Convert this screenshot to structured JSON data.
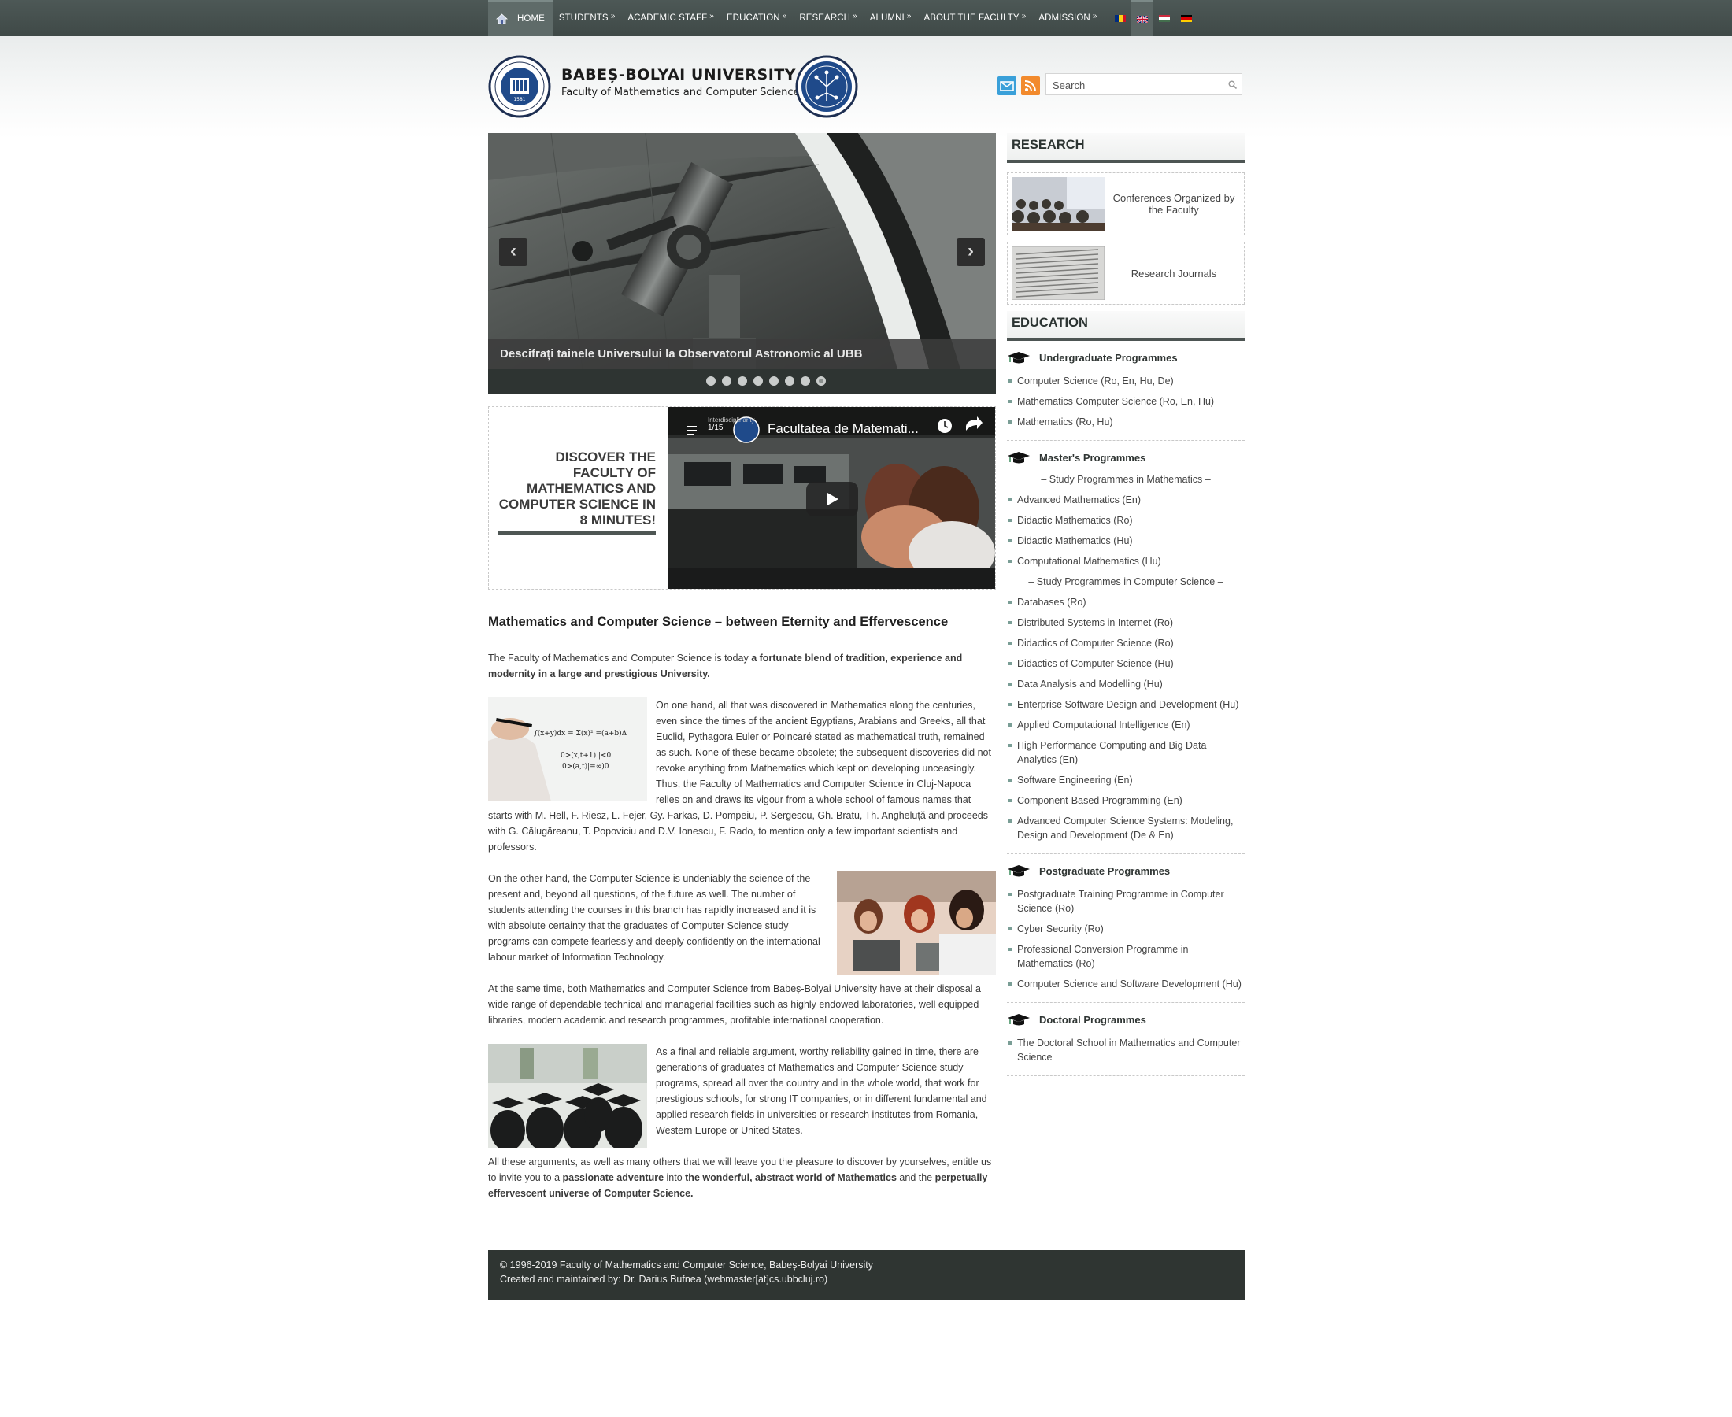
{
  "nav": {
    "items": [
      {
        "label": "HOME",
        "arrow": ""
      },
      {
        "label": "STUDENTS",
        "arrow": "»"
      },
      {
        "label": "ACADEMIC STAFF",
        "arrow": "»"
      },
      {
        "label": "EDUCATION",
        "arrow": "»"
      },
      {
        "label": "RESEARCH",
        "arrow": "»"
      },
      {
        "label": "ALUMNI",
        "arrow": "»"
      },
      {
        "label": "ABOUT THE FACULTY",
        "arrow": "»"
      },
      {
        "label": "ADMISSION",
        "arrow": "»"
      }
    ],
    "flags": [
      "romanian-flag-icon",
      "uk-flag-icon",
      "hungarian-flag-icon",
      "german-flag-icon"
    ],
    "bar_color": "#454f4d"
  },
  "header": {
    "title": "BABEȘ-BOLYAI UNIVERSITY",
    "subtitle": "Faculty of Mathematics and Computer Science",
    "seal_icon": "university-seal-icon",
    "faculty_icon": "faculty-logo-icon"
  },
  "search": {
    "placeholder": "Search",
    "value": ""
  },
  "slider": {
    "caption": "Descifrați tainele Universului la Observatorul Astronomic al UBB",
    "prev": "‹",
    "next": "›",
    "slide_count": 8,
    "active_slide": 8
  },
  "discover": {
    "text": "DISCOVER THE FACULTY OF MATHEMATICS AND COMPUTER SCIENCE IN 8 MINUTES!",
    "video_title": "Facultatea de Matemati...",
    "video_counter": "1/15",
    "video_tag": "Interdisciplinarity"
  },
  "article": {
    "title": "Mathematics and Computer Science – between Eternity and Effervescence",
    "p1_plain": "The Faculty of Mathematics and Computer Science is today ",
    "p1_bold": "a fortunate blend of tradition, experience and modernity in a large and prestigious University.",
    "p2": "On one hand, all that was discovered in Mathematics along the centuries, even since the times of the ancient Egyptians, Arabians and Greeks, all that Euclid, Pythagora Euler or Poincaré stated as mathematical truth, remained as such. None of these became obsolete; the subsequent discoveries did not revoke anything from Mathematics which kept on developing unceasingly. Thus, the Faculty of Mathematics and Computer Science in Cluj-Napoca relies on and draws its vigour from a whole school of famous names that starts with M. Hell, F. Riesz, L. Fejer, Gy. Farkas, D. Pompeiu, P. Sergescu, Gh. Bratu, Th. Angheluță and proceeds with G. Călugăreanu, T. Popoviciu and D.V. Ionescu, F. Rado, to mention only a few important scientists and professors.",
    "p3": "On the other hand, the Computer Science is undeniably the science of the present and, beyond all questions, of the future as well. The number of students attending the courses in this branch has rapidly increased and it is with absolute certainty that the graduates of Computer Science study programs can compete fearlessly and deeply confidently on the international labour market of Information Technology.",
    "p4": "At the same time, both Mathematics and Computer Science from Babeș-Bolyai University have at their disposal a wide range of dependable technical and managerial facilities such as highly endowed laboratories, well equipped libraries, modern academic and research programmes, profitable international cooperation.",
    "p5": "As a final and reliable argument, worthy reliability gained in time, there are generations of graduates of Mathematics and Computer Science study programs, spread all over the country and in the whole world, that work for prestigious schools, for strong IT companies, or in different fundamental and applied research fields in universities or research institutes from Romania, Western Europe or United States.",
    "p6_a": "All these arguments, as well as many others that we will leave you the pleasure to discover by yourselves, entitle us to invite you to a ",
    "p6_b": "passionate adventure",
    "p6_c": " into ",
    "p6_d": "the wonderful, abstract world of Mathematics",
    "p6_e": " and the ",
    "p6_f": "perpetually effervescent universe of Computer Science."
  },
  "sidebar": {
    "research_title": "RESEARCH",
    "research_items": [
      {
        "label": "Conferences Organized by the Faculty"
      },
      {
        "label": "Research Journals"
      }
    ],
    "education_title": "EDUCATION",
    "undergrad": {
      "title": "Undergraduate Programmes",
      "items": [
        "Computer Science (Ro, En, Hu, De)",
        "Mathematics Computer Science (Ro, En, Hu)",
        "Mathematics (Ro, Hu)"
      ]
    },
    "masters": {
      "title": "Master's Programmes",
      "math_heading": "– Study Programmes in Mathematics –",
      "math_items": [
        "Advanced Mathematics (En)",
        "Didactic Mathematics (Ro)",
        "Didactic Mathematics (Hu)",
        "Computational Mathematics (Hu)"
      ],
      "cs_heading": "– Study Programmes in Computer Science –",
      "cs_items": [
        "Databases (Ro)",
        "Distributed Systems in Internet (Ro)",
        "Didactics of Computer Science (Ro)",
        "Didactics of Computer Science (Hu)",
        "Data Analysis and Modelling (Hu)",
        "Enterprise Software Design and Development (Hu)",
        "Applied Computational Intelligence (En)",
        "High Performance Computing and Big Data Analytics (En)",
        "Software Engineering (En)",
        "Component-Based Programming (En)",
        "Advanced Computer Science Systems: Modeling, Design and Development (De & En)"
      ]
    },
    "postgrad": {
      "title": "Postgraduate Programmes",
      "items": [
        "Postgraduate Training Programme in Computer Science (Ro)",
        "Cyber Security (Ro)",
        "Professional Conversion Programme in Mathematics (Ro)",
        "Computer Science and Software Development (Hu)"
      ]
    },
    "doctoral": {
      "title": "Doctoral Programmes",
      "items": [
        "The Doctoral School in Mathematics and Computer Science"
      ]
    }
  },
  "footer": {
    "line1": "© 1996-2019 Faculty of Mathematics and Computer Science, Babeș-Bolyai University",
    "line2": "Created and maintained by: Dr. Darius Bufnea (webmaster[at]cs.ubbcluj.ro)"
  }
}
